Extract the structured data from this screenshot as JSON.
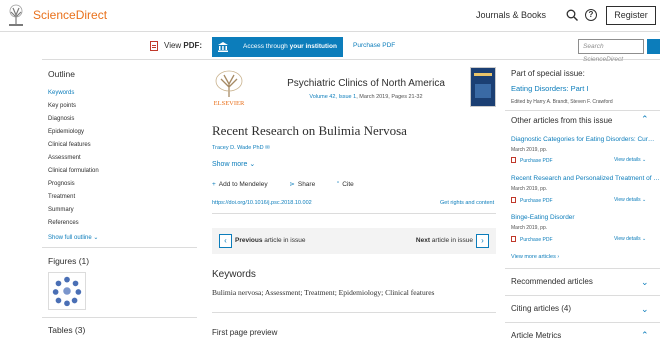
{
  "header": {
    "brand": "ScienceDirect",
    "journals_books": "Journals & Books",
    "register": "Register"
  },
  "toolbar": {
    "view_pdf_prefix": "View ",
    "view_pdf_bold": "PDF:",
    "access_prefix": "Access through ",
    "access_bold": "your institution",
    "purchase_pdf": "Purchase PDF",
    "search_placeholder": "Search ScienceDirect"
  },
  "outline": {
    "title": "Outline",
    "items": [
      "Keywords",
      "Key points",
      "Diagnosis",
      "Epidemiology",
      "Clinical features",
      "Assessment",
      "Clinical formulation",
      "Prognosis",
      "Treatment",
      "Summary",
      "References"
    ],
    "show_full": "Show full outline"
  },
  "figures": {
    "title": "Figures (1)"
  },
  "tables": {
    "title": "Tables (3)"
  },
  "article": {
    "publisher": "ELSEVIER",
    "journal": "Psychiatric Clinics of North America",
    "volume_link": "Volume 42, Issue 1",
    "volume_rest": ", March 2019, Pages 21-32",
    "title": "Recent Research on Bulimia Nervosa",
    "author": "Tracey D. Wade PhD",
    "show_more": "Show more",
    "add_mendeley": "Add to Mendeley",
    "share": "Share",
    "cite": "Cite",
    "doi": "https://doi.org/10.1016/j.psc.2018.10.002",
    "rights": "Get rights and content",
    "prev_bold": "Previous",
    "prev_rest": " article in issue",
    "next_bold": "Next",
    "next_rest": " article in issue",
    "keywords_title": "Keywords",
    "keywords": "Bulimia nervosa; Assessment; Treatment; Epidemiology; Clinical features",
    "first_page": "First page preview"
  },
  "right": {
    "special_label": "Part of special issue:",
    "special_link": "Eating Disorders: Part I",
    "editors": "Edited by Harry A. Brandt, Steven F. Crawford",
    "other_title": "Other articles from this issue",
    "other_articles": [
      {
        "title": "Diagnostic Categories for Eating Disorders: Cur…",
        "date": "March 2019, pp."
      },
      {
        "title": "Recent Research and Personalized Treatment of …",
        "date": "March 2019, pp."
      },
      {
        "title": "Binge-Eating Disorder",
        "date": "March 2019, pp."
      }
    ],
    "purchase_pdf": "Purchase PDF",
    "view_details": "View details",
    "view_more": "View more articles",
    "recommended": "Recommended articles",
    "citing": "Citing articles (4)",
    "metrics": "Article Metrics"
  },
  "colors": {
    "brand_orange": "#e9711c",
    "link_blue": "#0c7dbb"
  }
}
